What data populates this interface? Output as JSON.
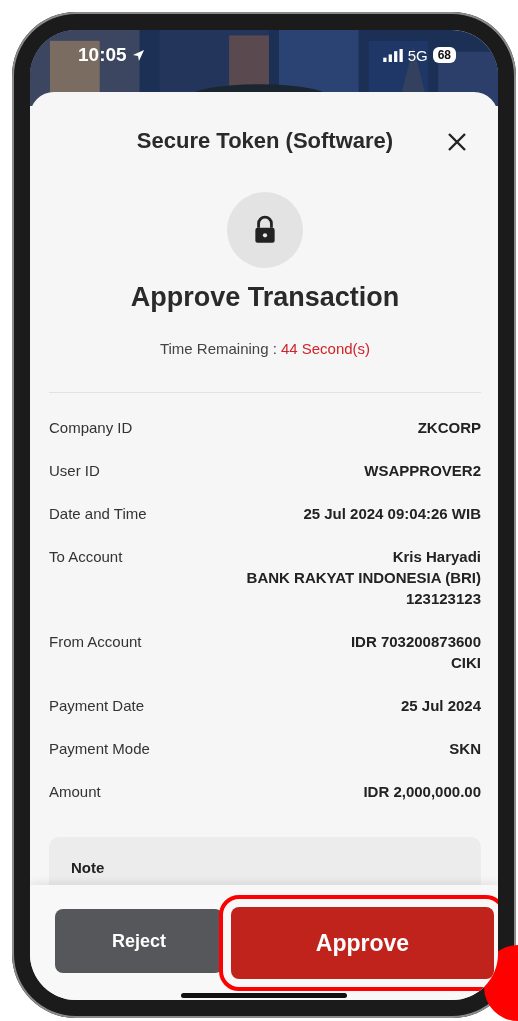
{
  "status_bar": {
    "time": "10:05",
    "network": "5G",
    "battery": "68"
  },
  "sheet": {
    "title": "Secure Token (Software)",
    "heading": "Approve Transaction",
    "time_remaining": {
      "label": "Time Remaining :",
      "value": "44 Second(s)"
    }
  },
  "details": [
    {
      "label": "Company ID",
      "value": [
        "ZKCORP"
      ]
    },
    {
      "label": "User ID",
      "value": [
        "WSAPPROVER2"
      ]
    },
    {
      "label": "Date and Time",
      "value": [
        "25 Jul 2024 09:04:26 WIB"
      ]
    },
    {
      "label": "To Account",
      "value": [
        "Kris Haryadi",
        "BANK RAKYAT INDONESIA (BRI)",
        "123123123"
      ]
    },
    {
      "label": "From Account",
      "value": [
        "IDR 703200873600",
        "CIKI"
      ]
    },
    {
      "label": "Payment Date",
      "value": [
        "25 Jul 2024"
      ]
    },
    {
      "label": "Payment Mode",
      "value": [
        "SKN"
      ]
    },
    {
      "label": "Amount",
      "value": [
        "IDR 2,000,000.00"
      ]
    }
  ],
  "note": {
    "title": "Note"
  },
  "buttons": [
    {
      "label": "Reject",
      "kind": "secondary",
      "highlighted": false
    },
    {
      "label": "Approve",
      "kind": "primary",
      "highlighted": true
    }
  ]
}
